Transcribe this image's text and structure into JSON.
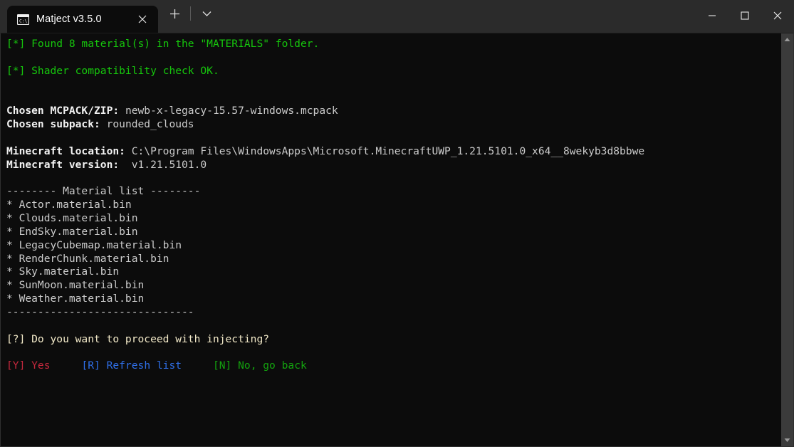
{
  "window": {
    "tab": {
      "title": "Matject v3.5.0",
      "icon": "console-window-icon",
      "icon_text": "C:\\",
      "close_label": "✕"
    },
    "new_tab_label": "+",
    "tab_menu_label": "⌄",
    "caption": {
      "minimize": "─",
      "maximize": "□",
      "close": "✕"
    }
  },
  "terminal": {
    "lines": [
      {
        "segments": [
          {
            "text": "[*] Found 8 material(s) in the \"MATERIALS\" folder.",
            "style": "green"
          }
        ]
      },
      {
        "segments": [
          {
            "text": "",
            "style": "dim"
          }
        ]
      },
      {
        "segments": [
          {
            "text": "[*] Shader compatibility check OK.",
            "style": "green"
          }
        ]
      },
      {
        "segments": [
          {
            "text": "",
            "style": "dim"
          }
        ]
      },
      {
        "segments": [
          {
            "text": "",
            "style": "dim"
          }
        ]
      },
      {
        "segments": [
          {
            "text": "Chosen MCPACK/ZIP:",
            "style": "white-bold"
          },
          {
            "text": " newb-x-legacy-15.57-windows.mcpack",
            "style": "dim"
          }
        ]
      },
      {
        "segments": [
          {
            "text": "Chosen subpack:",
            "style": "white-bold"
          },
          {
            "text": " rounded_clouds",
            "style": "dim"
          }
        ]
      },
      {
        "segments": [
          {
            "text": "",
            "style": "dim"
          }
        ]
      },
      {
        "segments": [
          {
            "text": "Minecraft location:",
            "style": "white-bold"
          },
          {
            "text": " C:\\Program Files\\WindowsApps\\Microsoft.MinecraftUWP_1.21.5101.0_x64__8wekyb3d8bbwe",
            "style": "dim"
          }
        ]
      },
      {
        "segments": [
          {
            "text": "Minecraft version:",
            "style": "white-bold"
          },
          {
            "text": "  v1.21.5101.0",
            "style": "dim"
          }
        ]
      },
      {
        "segments": [
          {
            "text": "",
            "style": "dim"
          }
        ]
      },
      {
        "segments": [
          {
            "text": "-------- Material list --------",
            "style": "dim"
          }
        ]
      },
      {
        "segments": [
          {
            "text": "* Actor.material.bin",
            "style": "dim"
          }
        ]
      },
      {
        "segments": [
          {
            "text": "* Clouds.material.bin",
            "style": "dim"
          }
        ]
      },
      {
        "segments": [
          {
            "text": "* EndSky.material.bin",
            "style": "dim"
          }
        ]
      },
      {
        "segments": [
          {
            "text": "* LegacyCubemap.material.bin",
            "style": "dim"
          }
        ]
      },
      {
        "segments": [
          {
            "text": "* RenderChunk.material.bin",
            "style": "dim"
          }
        ]
      },
      {
        "segments": [
          {
            "text": "* Sky.material.bin",
            "style": "dim"
          }
        ]
      },
      {
        "segments": [
          {
            "text": "* SunMoon.material.bin",
            "style": "dim"
          }
        ]
      },
      {
        "segments": [
          {
            "text": "* Weather.material.bin",
            "style": "dim"
          }
        ]
      },
      {
        "segments": [
          {
            "text": "------------------------------",
            "style": "dim"
          }
        ]
      },
      {
        "segments": [
          {
            "text": "",
            "style": "dim"
          }
        ]
      },
      {
        "segments": [
          {
            "text": "[?] Do you want to proceed with injecting?",
            "style": "yellow"
          }
        ]
      },
      {
        "segments": [
          {
            "text": "",
            "style": "dim"
          }
        ]
      },
      {
        "segments": [
          {
            "text": "[Y] Yes",
            "style": "red"
          },
          {
            "text": "     ",
            "style": "dim"
          },
          {
            "text": "[R] Refresh list",
            "style": "blue"
          },
          {
            "text": "     ",
            "style": "dim"
          },
          {
            "text": "[N] No, go back",
            "style": "green-dim"
          }
        ]
      }
    ],
    "prompt": {
      "question": "[?] Do you want to proceed with injecting?",
      "options": [
        {
          "key": "[Y]",
          "label": "Yes",
          "color": "#c5283d"
        },
        {
          "key": "[R]",
          "label": "Refresh list",
          "color": "#2f6fe8"
        },
        {
          "key": "[N]",
          "label": "No, go back",
          "color": "#13a10e"
        }
      ]
    },
    "summary": {
      "material_count": 8,
      "materials_folder": "MATERIALS",
      "mcpack": "newb-x-legacy-15.57-windows.mcpack",
      "subpack": "rounded_clouds",
      "minecraft_location": "C:\\Program Files\\WindowsApps\\Microsoft.MinecraftUWP_1.21.5101.0_x64__8wekyb3d8bbwe",
      "minecraft_version": "v1.21.5101.0",
      "material_list": [
        "Actor.material.bin",
        "Clouds.material.bin",
        "EndSky.material.bin",
        "LegacyCubemap.material.bin",
        "RenderChunk.material.bin",
        "Sky.material.bin",
        "SunMoon.material.bin",
        "Weather.material.bin"
      ]
    }
  },
  "scrollbar": {
    "up_arrow": "scroll-up-arrow",
    "down_arrow": "scroll-down-arrow"
  }
}
